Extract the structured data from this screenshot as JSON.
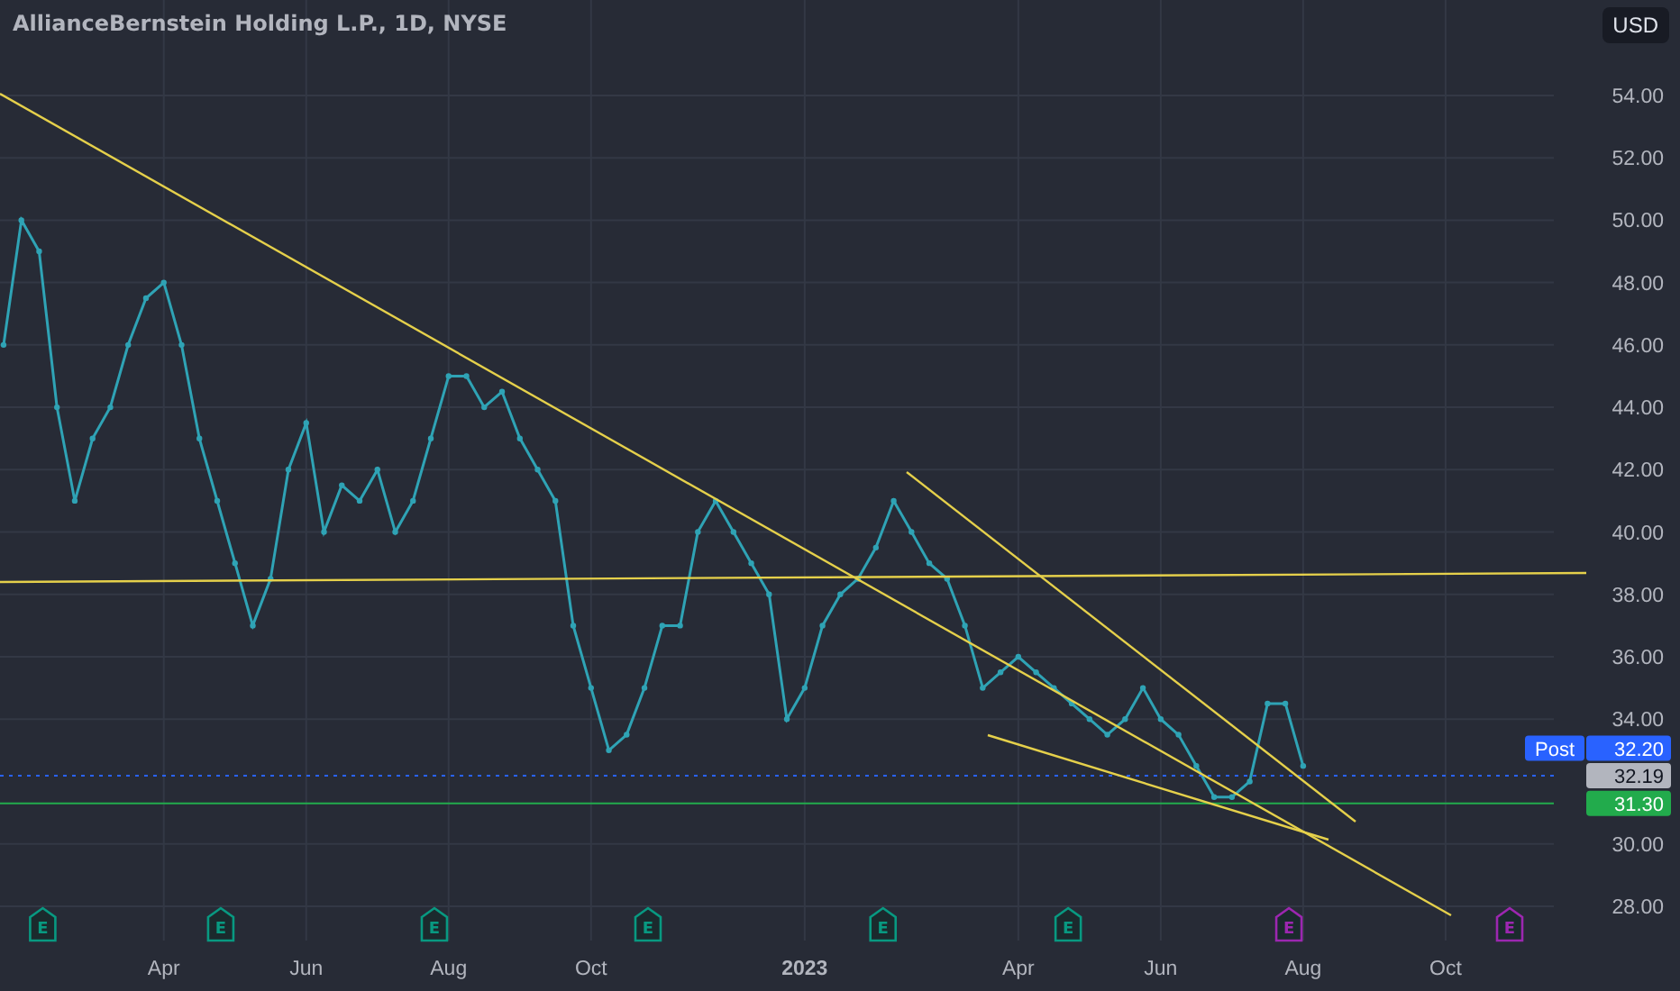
{
  "title": "AllianceBernstein Holding L.P., 1D, NYSE",
  "currency_button": "USD",
  "price_labels": [
    {
      "kind": "post",
      "tag": "Post",
      "value": "32.20"
    },
    {
      "kind": "last",
      "value": "32.19"
    },
    {
      "kind": "line",
      "value": "31.30"
    }
  ],
  "earnings_markers": [
    {
      "label": "E",
      "color": "#089981"
    },
    {
      "label": "E",
      "color": "#089981"
    },
    {
      "label": "E",
      "color": "#089981"
    },
    {
      "label": "E",
      "color": "#089981"
    },
    {
      "label": "E",
      "color": "#089981"
    },
    {
      "label": "E",
      "color": "#089981"
    },
    {
      "label": "E",
      "color": "#9c27b0"
    },
    {
      "label": "E",
      "color": "#9c27b0"
    }
  ],
  "chart_data": {
    "type": "line",
    "categories": [
      null,
      null,
      null,
      null,
      null,
      null,
      null,
      null,
      null,
      "Apr",
      null,
      null,
      null,
      null,
      null,
      null,
      null,
      "Jun",
      null,
      null,
      null,
      null,
      null,
      null,
      null,
      "Aug",
      null,
      null,
      null,
      null,
      null,
      null,
      null,
      "Oct",
      null,
      null,
      null,
      null,
      null,
      null,
      null,
      null,
      null,
      null,
      null,
      "2023",
      null,
      null,
      null,
      null,
      null,
      null,
      null,
      null,
      null,
      null,
      null,
      "Apr",
      null,
      null,
      null,
      null,
      null,
      null,
      null,
      "Jun",
      null,
      null,
      null,
      null,
      null,
      null,
      null,
      "Aug",
      null,
      null,
      null,
      null,
      null,
      null,
      null,
      "Oct",
      null,
      null,
      null,
      null,
      null,
      null
    ],
    "series": [
      {
        "color": "#2fa3b5",
        "marker": true,
        "values": [
          46,
          50,
          49,
          44,
          41,
          43,
          44,
          46,
          47.5,
          48,
          46,
          43,
          41,
          39,
          37,
          38.5,
          42,
          43.5,
          40,
          41.5,
          41,
          42,
          40,
          41,
          43,
          45,
          45,
          44,
          44.5,
          43,
          42,
          41,
          37,
          35,
          33,
          33.5,
          35,
          37,
          37,
          40,
          41,
          40,
          39,
          38,
          34,
          35,
          37,
          38,
          38.5,
          39.5,
          41,
          40,
          39,
          38.5,
          37,
          35,
          35.5,
          36,
          35.5,
          35,
          34.5,
          34,
          33.5,
          34,
          35,
          34,
          33.5,
          32.5,
          31.5,
          31.5,
          32,
          34.5,
          34.5,
          32.5,
          null,
          null,
          null,
          null,
          null,
          null,
          null,
          null,
          null,
          null,
          null,
          null,
          null,
          null
        ]
      }
    ],
    "ylim": [
      26.9,
      57.06
    ],
    "grid": true,
    "yticks": [
      {
        "value": 54,
        "label": "54.00"
      },
      {
        "value": 52,
        "label": "52.00"
      },
      {
        "value": 50,
        "label": "50.00"
      },
      {
        "value": 48,
        "label": "48.00"
      },
      {
        "value": 46,
        "label": "46.00"
      },
      {
        "value": 44,
        "label": "44.00"
      },
      {
        "value": 42,
        "label": "42.00"
      },
      {
        "value": 40,
        "label": "40.00"
      },
      {
        "value": 38,
        "label": "38.00"
      },
      {
        "value": 36,
        "label": "36.00"
      },
      {
        "value": 34,
        "label": "34.00"
      },
      {
        "value": 30,
        "label": "30.00"
      },
      {
        "value": 28,
        "label": "28.00"
      }
    ]
  }
}
